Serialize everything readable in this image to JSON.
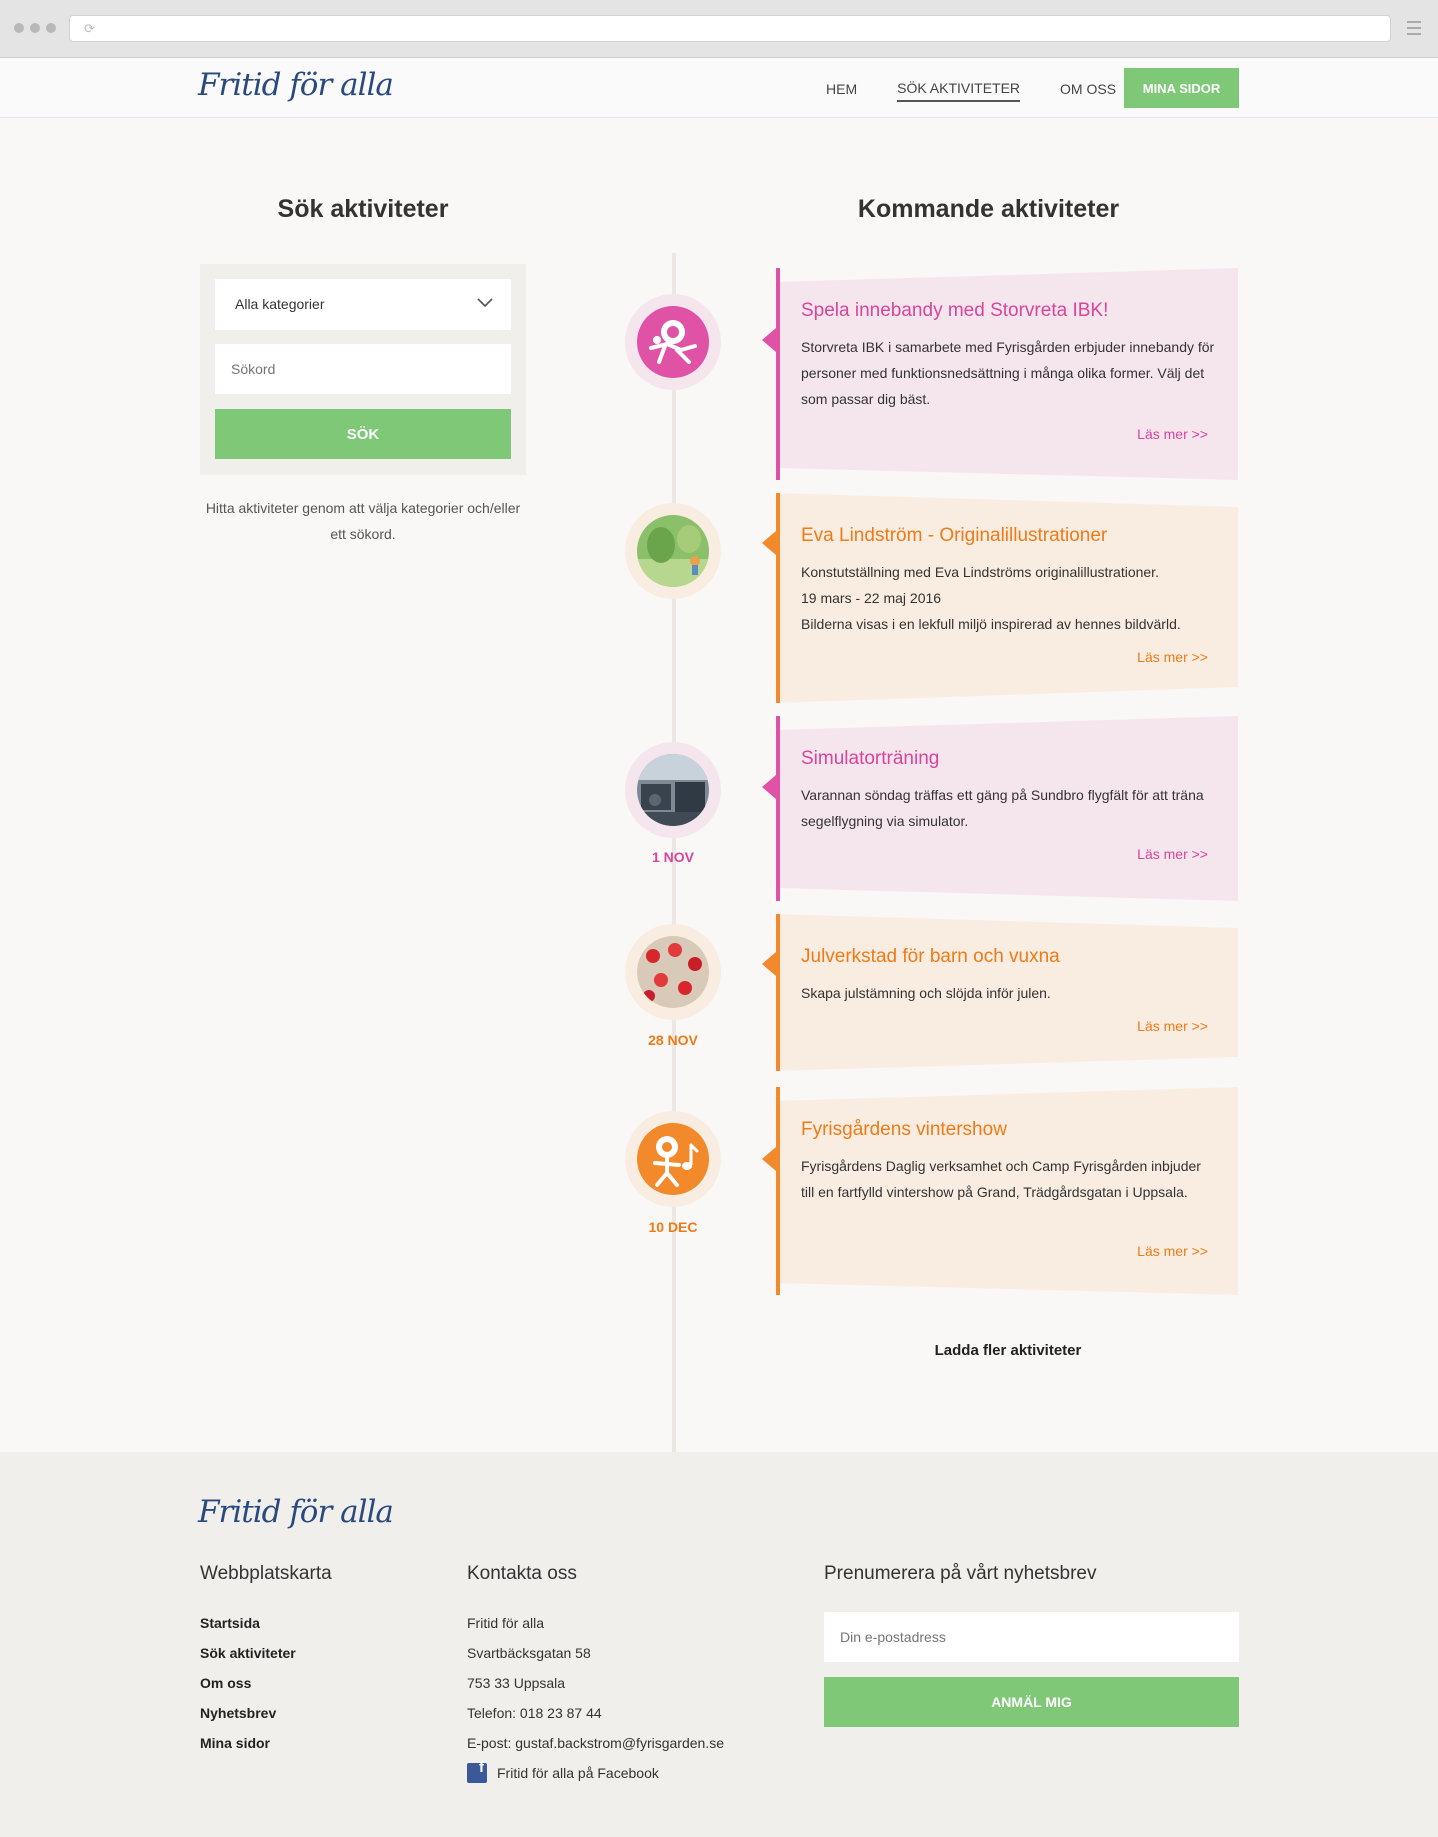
{
  "header": {
    "logo": "Fritid för alla",
    "nav": [
      "HEM",
      "SÖK AKTIVITETER",
      "OM OSS"
    ],
    "mina_sidor": "MINA SIDOR"
  },
  "search": {
    "title": "Sök aktiviteter",
    "category_value": "Alla kategorier",
    "keyword_placeholder": "Sökord",
    "button": "SÖK",
    "hint": "Hitta aktiviteter genom att välja kategorier och/eller ett sökord."
  },
  "upcoming": {
    "title": "Kommande aktiviteter",
    "items": [
      {
        "title": "Spela innebandy med Storvreta IBK!",
        "text": "Storvreta IBK i samarbete med Fyrisgården erbjuder innebandy för personer med funktionsnedsättning i många olika former. Välj det som passar dig bäst.",
        "more": "Läs mer >>",
        "date": "",
        "theme": "pink",
        "icon": "sport-person-icon"
      },
      {
        "title": "Eva Lindström - Originalillustrationer",
        "text": "Konstutställning med Eva Lindströms originalillustrationer.",
        "text2": "19 mars - 22 maj 2016",
        "text3": "Bilderna visas i en lekfull miljö inspirerad av hennes bildvärld.",
        "more": "Läs mer >>",
        "date": "",
        "theme": "orange",
        "icon": "illustration-thumbnail"
      },
      {
        "title": "Simulatorträning",
        "text": "Varannan söndag träffas ett gäng på Sundbro flygfält för att träna segelflygning via simulator.",
        "more": "Läs mer >>",
        "date": "1 NOV",
        "theme": "pink",
        "icon": "simulator-thumbnail"
      },
      {
        "title": "Julverkstad för barn och vuxna",
        "text": "Skapa julstämning och slöjda inför julen.",
        "more": "Läs mer >>",
        "date": "28 NOV",
        "theme": "orange",
        "icon": "christmas-thumbnail"
      },
      {
        "title": "Fyrisgårdens vintershow",
        "text": "Fyrisgårdens Daglig verksamhet och Camp Fyrisgården inbjuder till en fartfylld vintershow på Grand, Trädgårdsgatan i Uppsala.",
        "more": "Läs mer >>",
        "date": "10 DEC",
        "theme": "orange",
        "icon": "music-person-icon"
      }
    ],
    "load_more": "Ladda fler aktiviteter"
  },
  "colors": {
    "green": "#7ec878",
    "pink": "#e052a6",
    "orange": "#f2892a",
    "logo": "#2a4a7f"
  },
  "footer": {
    "logo": "Fritid för alla",
    "sitemap_title": "Webbplatskarta",
    "sitemap": [
      "Startsida",
      "Sök aktiviteter",
      "Om oss",
      "Nyhetsbrev",
      "Mina sidor"
    ],
    "contact_title": "Kontakta oss",
    "contact": [
      "Fritid för alla",
      "Svartbäcksgatan 58",
      "753 33 Uppsala",
      "Telefon: 018 23 87 44",
      "E-post: gustaf.backstrom@fyrisgarden.se"
    ],
    "facebook": "Fritid för alla på Facebook",
    "newsletter_title": "Prenumerera på vårt nyhetsbrev",
    "email_placeholder": "Din e-postadress",
    "subscribe": "ANMÄL MIG"
  }
}
